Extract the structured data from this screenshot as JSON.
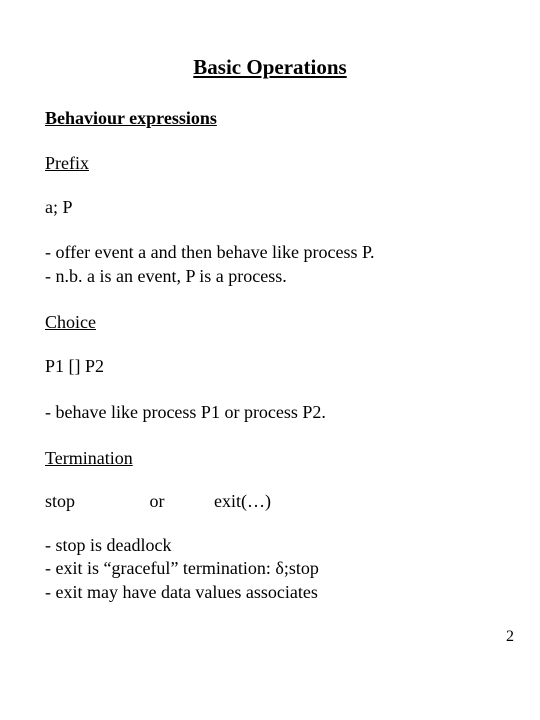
{
  "title": "Basic Operations",
  "sections": {
    "behaviour": "Behaviour expressions",
    "prefix": {
      "heading": "Prefix",
      "notation": "a; P",
      "b1": "- offer event a and then behave like process P.",
      "b2": "- n.b. a is an event, P is a process."
    },
    "choice": {
      "heading": "Choice",
      "notation": "P1 [] P2",
      "b1": "- behave like process P1 or process P2."
    },
    "termination": {
      "heading": "Termination",
      "col1": "stop",
      "col2": "or",
      "col3": "exit(…)",
      "b1": "- stop is deadlock",
      "b2": "- exit is “graceful” termination: δ;stop",
      "b3": "- exit may have data values associates"
    }
  },
  "page_number": "2"
}
